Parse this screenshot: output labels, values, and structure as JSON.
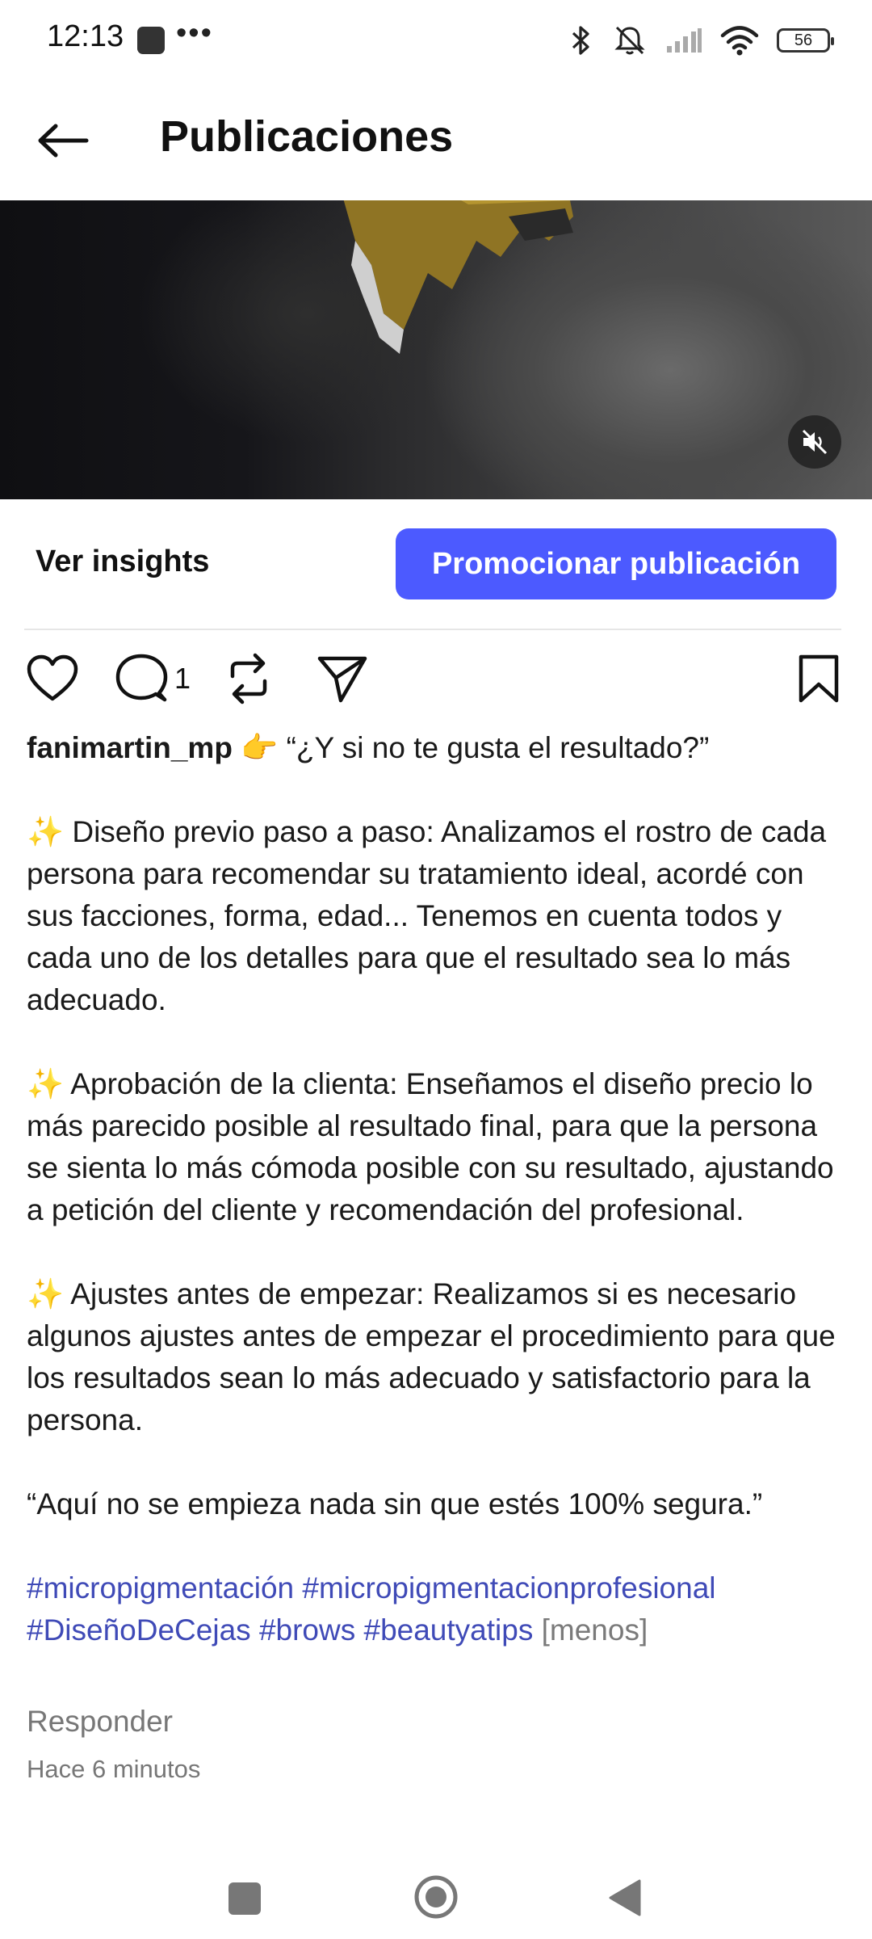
{
  "status_bar": {
    "time": "12:13",
    "more": "•••",
    "battery": "56"
  },
  "header": {
    "title": "Publicaciones"
  },
  "insights": {
    "ver_insights": "Ver insights",
    "promote": "Promocionar publicación"
  },
  "actions": {
    "comment_count": "1"
  },
  "post": {
    "username": "fanimartin_mp",
    "first_line": "👉 “¿Y si no te gusta el resultado?”",
    "paragraph_1": "✨ Diseño previo paso a paso: Analizamos el rostro de cada persona para recomendar su tratamiento ideal, acordé con sus facciones, forma, edad... Tenemos en cuenta todos y cada uno de los detalles para que el resultado sea lo más adecuado.",
    "paragraph_2": "✨ Aprobación de la clienta: Enseñamos el diseño precio lo más parecido posible al resultado final, para que la persona se sienta lo más cómoda posible con su resultado, ajustando a petición del cliente y recomendación del profesional.",
    "paragraph_3": "✨ Ajustes antes de empezar: Realizamos si es necesario algunos ajustes antes de empezar el procedimiento para que los resultados sean lo más adecuado y satisfactorio para la persona.",
    "quote": "“Aquí no se empieza nada sin que estés 100% segura.”",
    "hashtags": [
      "#micropigmentación",
      "#micropigmentacionprofesional",
      "#DiseñoDeCejas",
      "#brows",
      "#beautyatips"
    ],
    "less": "[menos]",
    "reply": "Responder",
    "time_ago": "Hace 6 minutos"
  },
  "colors": {
    "accent": "#4c5aff",
    "hashtag": "#3f4ab7"
  }
}
